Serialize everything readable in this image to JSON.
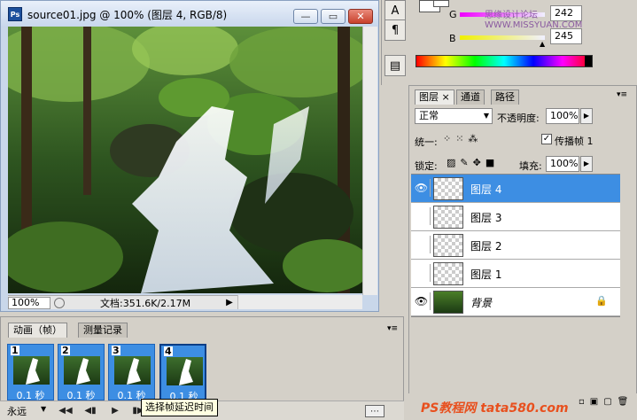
{
  "document": {
    "title": "source01.jpg @ 100% (图层 4, RGB/8)",
    "zoom": "100%",
    "doc_info": "文档:351.6K/2.17M"
  },
  "window_buttons": {
    "minimize": "—",
    "maximize": "▭",
    "close": "✕"
  },
  "animation": {
    "tabs": [
      "动画（帧）",
      "测量记录"
    ],
    "frames": [
      {
        "num": "1",
        "delay": "0.1 秒"
      },
      {
        "num": "2",
        "delay": "0.1 秒"
      },
      {
        "num": "3",
        "delay": "0.1 秒"
      },
      {
        "num": "4",
        "delay": "0.1 秒"
      }
    ],
    "loop": "永远",
    "tooltip": "选择帧延迟时间"
  },
  "color": {
    "g_label": "G",
    "b_label": "B",
    "g_value": "242",
    "b_value": "245",
    "watermark_top": "思缘设计论坛 WWW.MISSYUAN.COM"
  },
  "layers": {
    "tabs": [
      "图层",
      "通道",
      "路径"
    ],
    "blend_mode": "正常",
    "opacity_label": "不透明度:",
    "opacity": "100%",
    "unify_label": "统一:",
    "propagate_label": "传播帧 1",
    "lock_label": "锁定:",
    "fill_label": "填充:",
    "fill": "100%",
    "items": [
      {
        "name": "图层 4",
        "visible": true,
        "selected": true
      },
      {
        "name": "图层 3",
        "visible": false,
        "selected": false
      },
      {
        "name": "图层 2",
        "visible": false,
        "selected": false
      },
      {
        "name": "图层 1",
        "visible": false,
        "selected": false
      },
      {
        "name": "背景",
        "visible": true,
        "selected": false
      }
    ]
  },
  "watermark_bottom": "PS教程网 tata580.com",
  "colors": {
    "selection": "#3d8ee3",
    "watermark": "#e8501e"
  }
}
